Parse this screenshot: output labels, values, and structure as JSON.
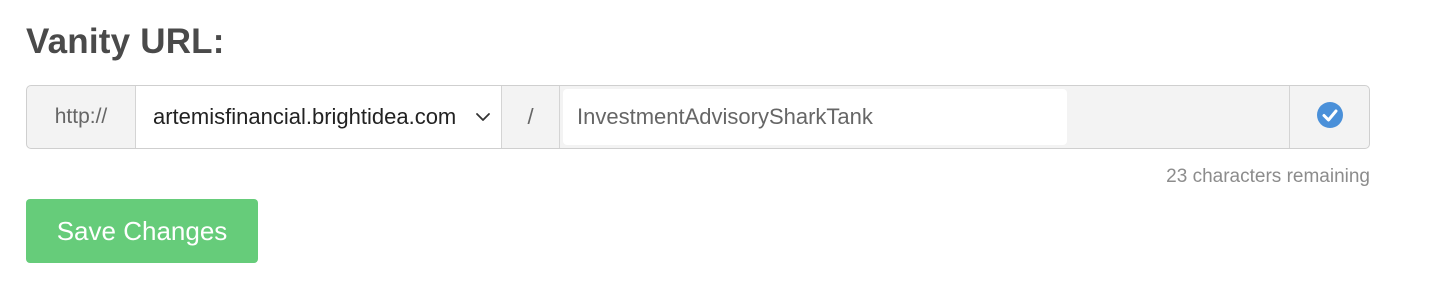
{
  "form": {
    "heading": "Vanity URL:",
    "protocol_prefix": "http://",
    "domain": {
      "selected": "artemisfinancial.brightidea.com",
      "icon": "chevron-down-icon"
    },
    "path_separator": "/",
    "path": {
      "value": "InvestmentAdvisorySharkTank"
    },
    "validation": {
      "icon": "check-circle-icon",
      "color": "#4a90d9"
    },
    "characters_remaining": "23 characters remaining",
    "save_label": "Save Changes",
    "save_color": "#66cc7a"
  }
}
